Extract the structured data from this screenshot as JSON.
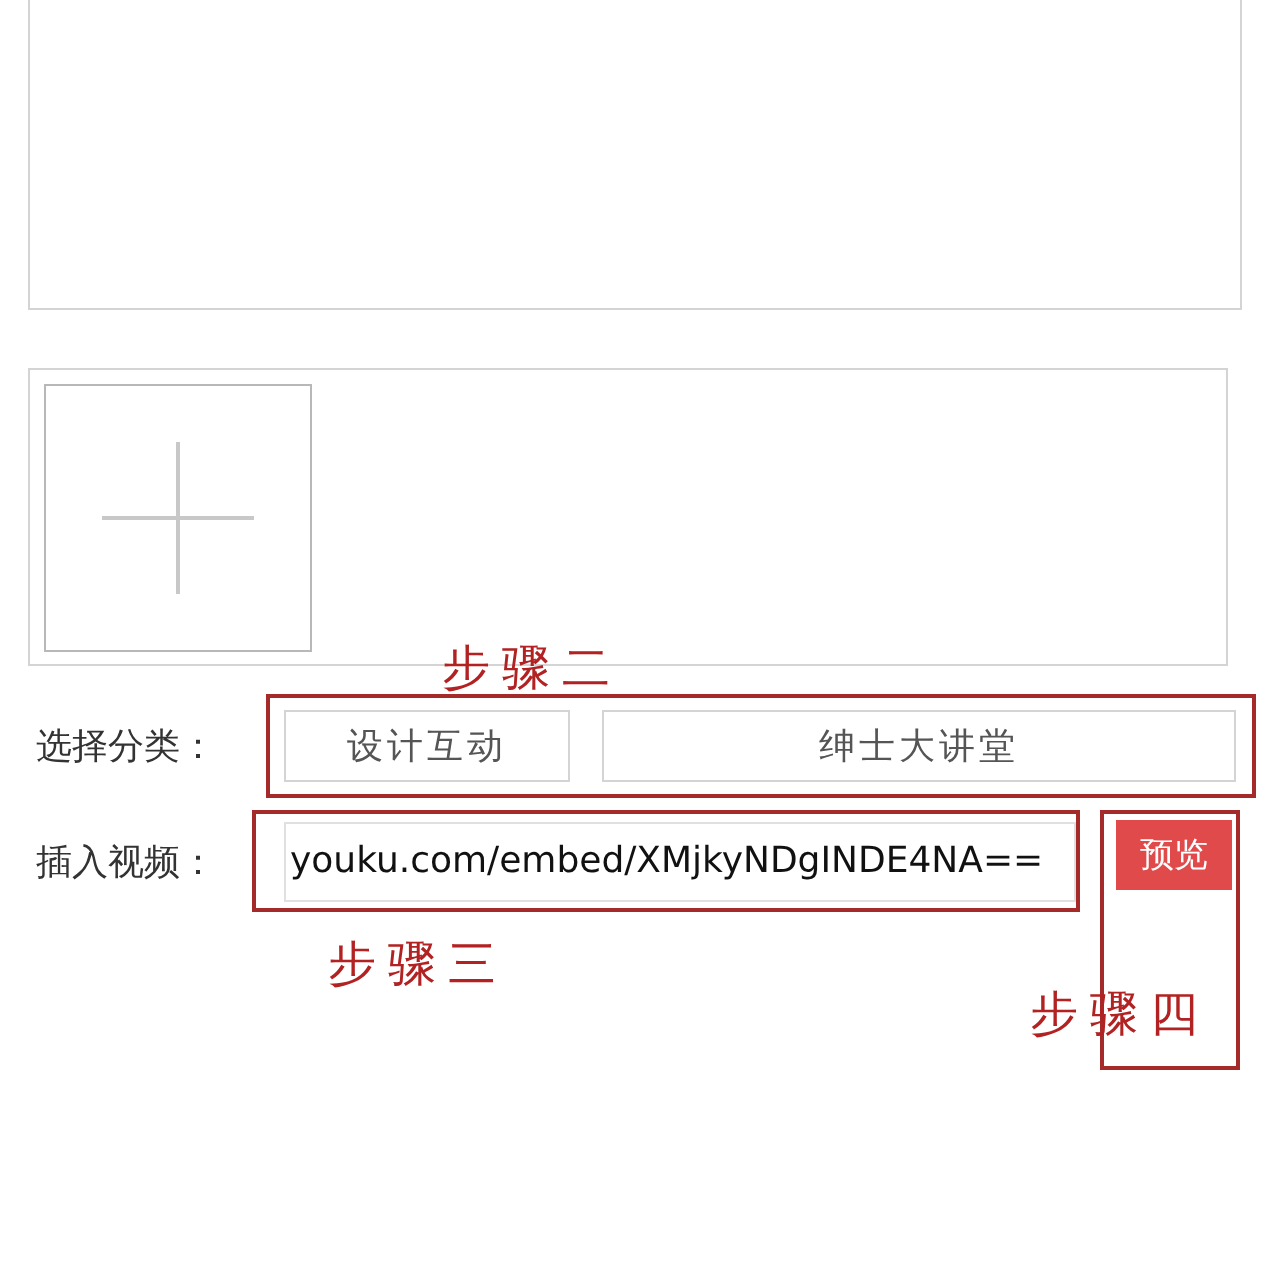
{
  "categories": {
    "label": "选择分类：",
    "options": [
      "设计互动",
      "绅士大讲堂"
    ],
    "annotation": "步骤二"
  },
  "video": {
    "label": "插入视频：",
    "value": "youku.com/embed/XMjkyNDgINDE4NA==",
    "annotation": "步骤三"
  },
  "preview": {
    "button": "预览",
    "annotation": "步骤四"
  }
}
